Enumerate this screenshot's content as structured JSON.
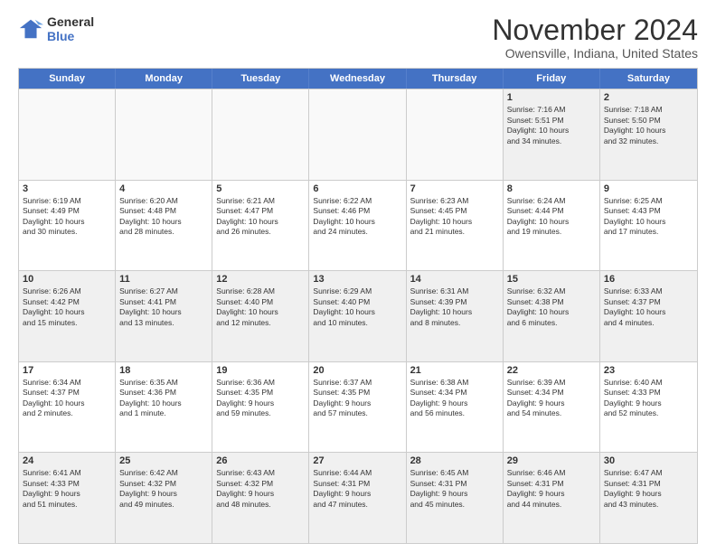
{
  "logo": {
    "line1": "General",
    "line2": "Blue"
  },
  "title": "November 2024",
  "subtitle": "Owensville, Indiana, United States",
  "headers": [
    "Sunday",
    "Monday",
    "Tuesday",
    "Wednesday",
    "Thursday",
    "Friday",
    "Saturday"
  ],
  "rows": [
    [
      {
        "day": "",
        "info": ""
      },
      {
        "day": "",
        "info": ""
      },
      {
        "day": "",
        "info": ""
      },
      {
        "day": "",
        "info": ""
      },
      {
        "day": "",
        "info": ""
      },
      {
        "day": "1",
        "info": "Sunrise: 7:16 AM\nSunset: 5:51 PM\nDaylight: 10 hours\nand 34 minutes."
      },
      {
        "day": "2",
        "info": "Sunrise: 7:18 AM\nSunset: 5:50 PM\nDaylight: 10 hours\nand 32 minutes."
      }
    ],
    [
      {
        "day": "3",
        "info": "Sunrise: 6:19 AM\nSunset: 4:49 PM\nDaylight: 10 hours\nand 30 minutes."
      },
      {
        "day": "4",
        "info": "Sunrise: 6:20 AM\nSunset: 4:48 PM\nDaylight: 10 hours\nand 28 minutes."
      },
      {
        "day": "5",
        "info": "Sunrise: 6:21 AM\nSunset: 4:47 PM\nDaylight: 10 hours\nand 26 minutes."
      },
      {
        "day": "6",
        "info": "Sunrise: 6:22 AM\nSunset: 4:46 PM\nDaylight: 10 hours\nand 24 minutes."
      },
      {
        "day": "7",
        "info": "Sunrise: 6:23 AM\nSunset: 4:45 PM\nDaylight: 10 hours\nand 21 minutes."
      },
      {
        "day": "8",
        "info": "Sunrise: 6:24 AM\nSunset: 4:44 PM\nDaylight: 10 hours\nand 19 minutes."
      },
      {
        "day": "9",
        "info": "Sunrise: 6:25 AM\nSunset: 4:43 PM\nDaylight: 10 hours\nand 17 minutes."
      }
    ],
    [
      {
        "day": "10",
        "info": "Sunrise: 6:26 AM\nSunset: 4:42 PM\nDaylight: 10 hours\nand 15 minutes."
      },
      {
        "day": "11",
        "info": "Sunrise: 6:27 AM\nSunset: 4:41 PM\nDaylight: 10 hours\nand 13 minutes."
      },
      {
        "day": "12",
        "info": "Sunrise: 6:28 AM\nSunset: 4:40 PM\nDaylight: 10 hours\nand 12 minutes."
      },
      {
        "day": "13",
        "info": "Sunrise: 6:29 AM\nSunset: 4:40 PM\nDaylight: 10 hours\nand 10 minutes."
      },
      {
        "day": "14",
        "info": "Sunrise: 6:31 AM\nSunset: 4:39 PM\nDaylight: 10 hours\nand 8 minutes."
      },
      {
        "day": "15",
        "info": "Sunrise: 6:32 AM\nSunset: 4:38 PM\nDaylight: 10 hours\nand 6 minutes."
      },
      {
        "day": "16",
        "info": "Sunrise: 6:33 AM\nSunset: 4:37 PM\nDaylight: 10 hours\nand 4 minutes."
      }
    ],
    [
      {
        "day": "17",
        "info": "Sunrise: 6:34 AM\nSunset: 4:37 PM\nDaylight: 10 hours\nand 2 minutes."
      },
      {
        "day": "18",
        "info": "Sunrise: 6:35 AM\nSunset: 4:36 PM\nDaylight: 10 hours\nand 1 minute."
      },
      {
        "day": "19",
        "info": "Sunrise: 6:36 AM\nSunset: 4:35 PM\nDaylight: 9 hours\nand 59 minutes."
      },
      {
        "day": "20",
        "info": "Sunrise: 6:37 AM\nSunset: 4:35 PM\nDaylight: 9 hours\nand 57 minutes."
      },
      {
        "day": "21",
        "info": "Sunrise: 6:38 AM\nSunset: 4:34 PM\nDaylight: 9 hours\nand 56 minutes."
      },
      {
        "day": "22",
        "info": "Sunrise: 6:39 AM\nSunset: 4:34 PM\nDaylight: 9 hours\nand 54 minutes."
      },
      {
        "day": "23",
        "info": "Sunrise: 6:40 AM\nSunset: 4:33 PM\nDaylight: 9 hours\nand 52 minutes."
      }
    ],
    [
      {
        "day": "24",
        "info": "Sunrise: 6:41 AM\nSunset: 4:33 PM\nDaylight: 9 hours\nand 51 minutes."
      },
      {
        "day": "25",
        "info": "Sunrise: 6:42 AM\nSunset: 4:32 PM\nDaylight: 9 hours\nand 49 minutes."
      },
      {
        "day": "26",
        "info": "Sunrise: 6:43 AM\nSunset: 4:32 PM\nDaylight: 9 hours\nand 48 minutes."
      },
      {
        "day": "27",
        "info": "Sunrise: 6:44 AM\nSunset: 4:31 PM\nDaylight: 9 hours\nand 47 minutes."
      },
      {
        "day": "28",
        "info": "Sunrise: 6:45 AM\nSunset: 4:31 PM\nDaylight: 9 hours\nand 45 minutes."
      },
      {
        "day": "29",
        "info": "Sunrise: 6:46 AM\nSunset: 4:31 PM\nDaylight: 9 hours\nand 44 minutes."
      },
      {
        "day": "30",
        "info": "Sunrise: 6:47 AM\nSunset: 4:31 PM\nDaylight: 9 hours\nand 43 minutes."
      }
    ]
  ]
}
